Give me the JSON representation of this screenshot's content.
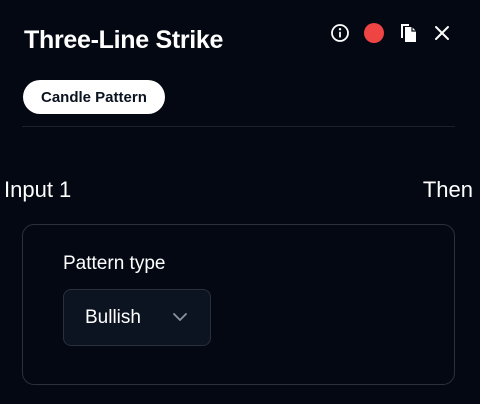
{
  "header": {
    "title": "Three-Line Strike",
    "tag": "Candle Pattern",
    "status_color": "#ef4444",
    "icons": [
      "info-icon",
      "status-dot",
      "copy-icon",
      "close-icon"
    ]
  },
  "node": {
    "input_label": "Input 1",
    "output_label": "Then"
  },
  "pattern_type": {
    "label": "Pattern type",
    "selected": "Bullish"
  }
}
